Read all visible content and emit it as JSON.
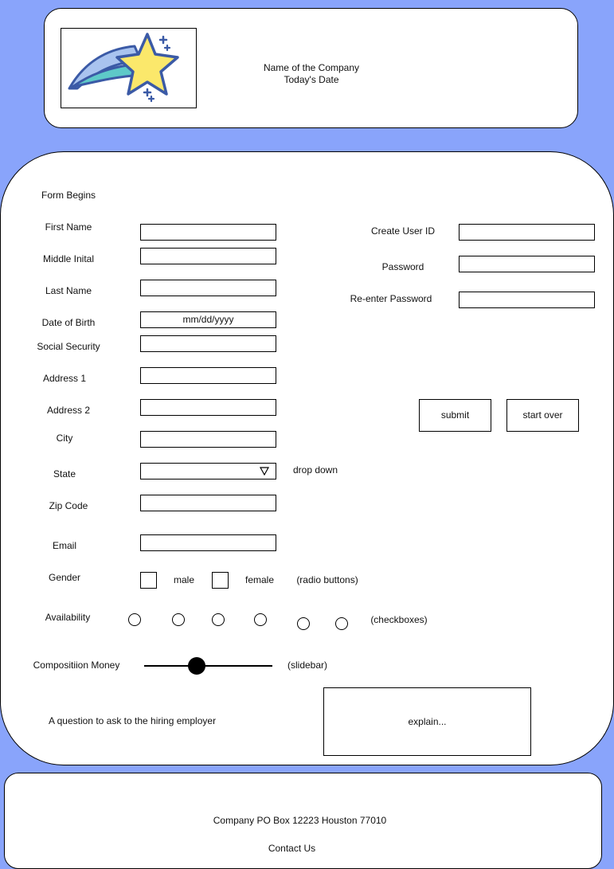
{
  "header": {
    "logo_icon": "shooting-star-icon",
    "company_name": "Name of the Company",
    "date_text": "Today's Date"
  },
  "form": {
    "title": "Form Begins",
    "labels": {
      "first_name": "First Name",
      "middle_initial": "Middle Inital",
      "last_name": "Last Name",
      "dob": "Date of Birth",
      "ssn": "Social Security",
      "address1": "Address 1",
      "address2": "Address 2",
      "city": "City",
      "state": "State",
      "zip": "Zip Code",
      "email": "Email",
      "gender": "Gender",
      "availability": "Availability",
      "compensation": "Compositiion Money",
      "question": "A question to ask to the hiring employer",
      "user_id": "Create User ID",
      "password": "Password",
      "reenter_password": "Re-enter Password"
    },
    "dob_placeholder": "mm/dd/yyyy",
    "state_note": "drop down",
    "gender_options": [
      "male",
      "female"
    ],
    "gender_note": "(radio buttons)",
    "availability_note": "(checkboxes)",
    "slider_value_fraction": 0.41,
    "slider_note": "(slidebar)",
    "question_placeholder": "explain...",
    "buttons": {
      "submit": "submit",
      "start_over": "start over"
    }
  },
  "footer": {
    "address": "Company PO Box 12223 Houston 77010",
    "contact": "Contact Us"
  }
}
